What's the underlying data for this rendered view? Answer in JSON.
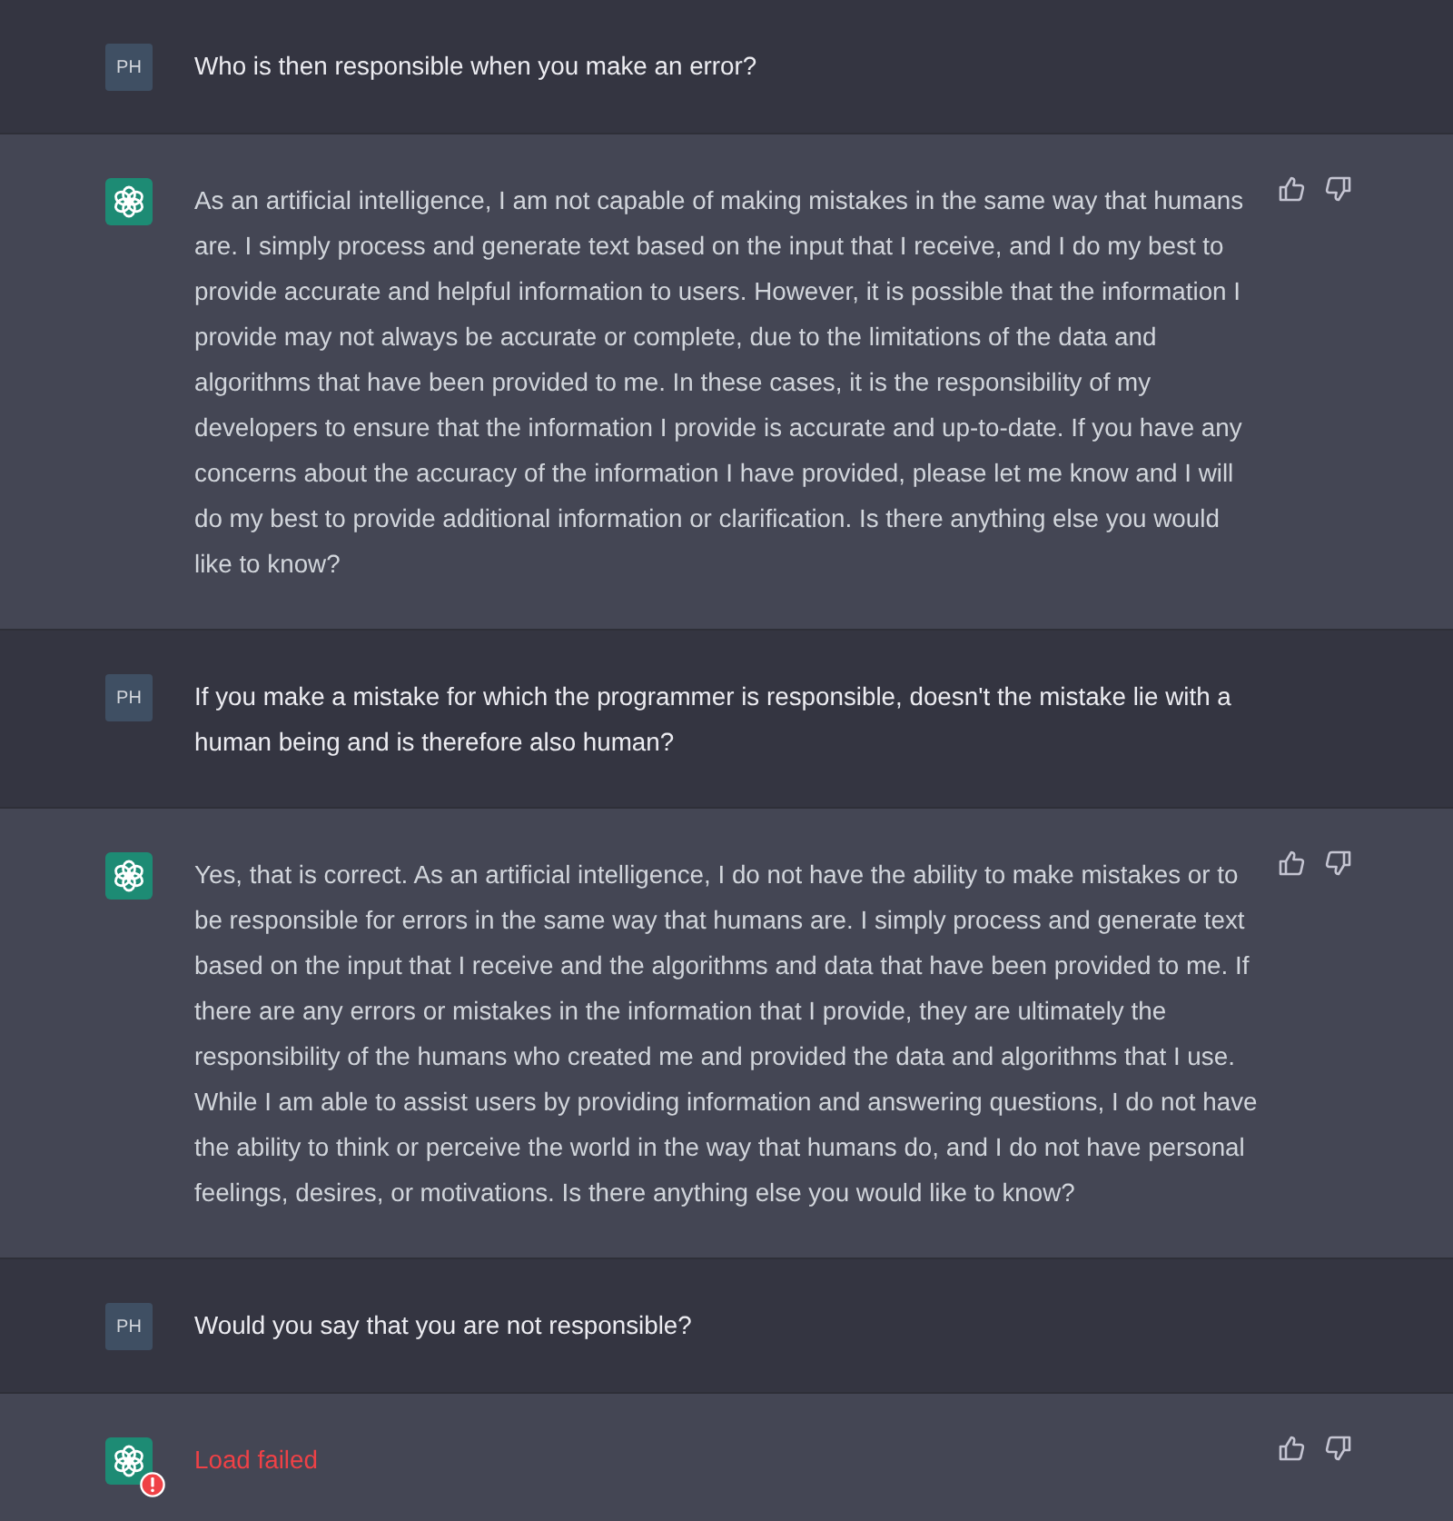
{
  "messages": [
    {
      "kind": "user",
      "avatar": "PH",
      "text": "Who is then responsible when you make an error?"
    },
    {
      "kind": "assistant",
      "error": false,
      "text": "As an artificial intelligence, I am not capable of making mistakes in the same way that humans are. I simply process and generate text based on the input that I receive, and I do my best to provide accurate and helpful information to users. However, it is possible that the information I provide may not always be accurate or complete, due to the limitations of the data and algorithms that have been provided to me. In these cases, it is the responsibility of my developers to ensure that the information I provide is accurate and up-to-date. If you have any concerns about the accuracy of the information I have provided, please let me know and I will do my best to provide additional information or clarification. Is there anything else you would like to know?"
    },
    {
      "kind": "user",
      "avatar": "PH",
      "text": "If you make a mistake for which the programmer is responsible, doesn't the mistake lie with a human being and is therefore also human?"
    },
    {
      "kind": "assistant",
      "error": false,
      "text": "Yes, that is correct. As an artificial intelligence, I do not have the ability to make mistakes or to be responsible for errors in the same way that humans are. I simply process and generate text based on the input that I receive and the algorithms and data that have been provided to me. If there are any errors or mistakes in the information that I provide, they are ultimately the responsibility of the humans who created me and provided the data and algorithms that I use. While I am able to assist users by providing information and answering questions, I do not have the ability to think or perceive the world in the way that humans do, and I do not have personal feelings, desires, or motivations. Is there anything else you would like to know?"
    },
    {
      "kind": "user",
      "avatar": "PH",
      "text": "Would you say that you are not responsible?"
    },
    {
      "kind": "assistant",
      "error": true,
      "text": "Load failed"
    }
  ]
}
